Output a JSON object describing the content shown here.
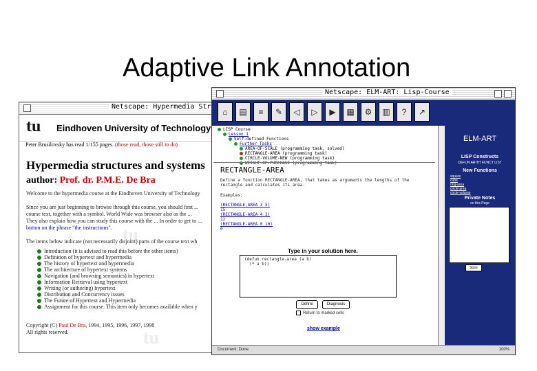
{
  "slide": {
    "title": "Adaptive Link Annotation"
  },
  "left_window": {
    "title": "Netscape: Hypermedia Structu",
    "logo": "tu",
    "university": "Eindhoven University of Technology",
    "pages_line": {
      "text": "Peter Brusilovsky has read 1/155 pages.",
      "links": "(those read, those still to do)"
    },
    "heading": "Hypermedia structures and systems",
    "author_label": "author:",
    "author_name": "Prof. dr. P.M.E. De Bra",
    "paragraphs": [
      "Welcome to the hypermedia course at the Eindhoven University of Technology",
      "Since you are just beginning to browse through this course, you should first ...",
      "course text, together with a symbol. World Wide was browser also as the ...",
      "They also explain how you can study this course with the ... In order to get to ...",
      "button on the phrase \"the instructions\"."
    ],
    "intro_line": "The items below indicate (not necessarily disjoint) parts of the course text wh",
    "toc": [
      "Introduction (it is advised to read this before the other items)",
      "Definition of hypertext and hypermedia",
      "The history of hypertext and hypermedia",
      "The architecture of hypertext systems",
      "Navigation (and browsing semantics) in hypertext",
      "Information Retrieval using hypertext",
      "Writing (or authoring) hypertext",
      "Distribution and Concurrency issues",
      "The Future of Hypertext and Hypermedia",
      "Assignment for this course. This item only becomes available when y"
    ],
    "copyright": {
      "prefix": "Copyright (C)",
      "name": "Paul De Bra",
      "years": "1994, 1995, 1996, 1997, 1998",
      "rights": "All rights reserved."
    }
  },
  "right_window": {
    "title": "Netscape: ELM-ART: Lisp-Course",
    "toolbar_icons": [
      "home-icon",
      "book-icon",
      "list-icon",
      "notes-icon",
      "back-icon",
      "forward-icon",
      "next-icon",
      "document-icon",
      "tools-icon",
      "info-icon",
      "help-icon",
      "exit-icon"
    ],
    "tree": [
      {
        "label": "LISP Course",
        "level": 0,
        "color": "#1a9a1a"
      },
      {
        "label": "Lesson 1",
        "level": 1,
        "color": "#1a9a1a"
      },
      {
        "label": "Self-defined Functions",
        "level": 2,
        "color": "#1a9a1a"
      },
      {
        "label": "Further Tasks",
        "level": 3,
        "color": "#1a9a1a"
      },
      {
        "label": "AREA-OF-SCALE (programming task, solved)",
        "level": 4,
        "color": "#1a9a1a"
      },
      {
        "label": "RECTANGLE-AREA (programming task)",
        "level": 4,
        "color": "#d02020"
      },
      {
        "label": "CIRCLE-VOLUME-NEW (programming task)",
        "level": 4,
        "color": "#1a9a1a"
      },
      {
        "label": "WEIGHT-OF-PURCHASE (programming task)",
        "level": 4,
        "color": "#1a9a1a"
      }
    ],
    "section_title": "RECTANGLE-AREA",
    "task_text": [
      "Define a function RECTANGLE-AREA, that takes as arguments the lengths of the",
      "rectangle and calculates its area."
    ],
    "examples_label": "Examples:",
    "examples": [
      "(RECTANGLE-AREA 3 5)",
      "15",
      "(RECTANGLE-AREA 4 3)",
      "12",
      "(RECTANGLE-AREA 0 10)",
      "0"
    ],
    "solution_label": "Type in your solution here.",
    "solution_code": "(defun rectangle-area (a b)\n  (* a b))",
    "buttons": {
      "define": "Define",
      "diagnosis": "Diagnosis"
    },
    "checkbox_label": "Return to marked cells",
    "show_example": "show example",
    "sidebar": {
      "logo": "ELM-ART",
      "heading_lisp": "LISP Constructs",
      "lisp_items": "DEFUN  ARITH  FUNCT  LIST",
      "heading_new": "New Functions",
      "new_items": [
        "square",
        "cube",
        "ring-area",
        "circle-area",
        "circle-volume"
      ],
      "heading_notes": "Private Notes",
      "notes_sub": "on this Page",
      "store": "Store"
    },
    "status": {
      "text": "Document: Done",
      "pct": "100%"
    }
  }
}
